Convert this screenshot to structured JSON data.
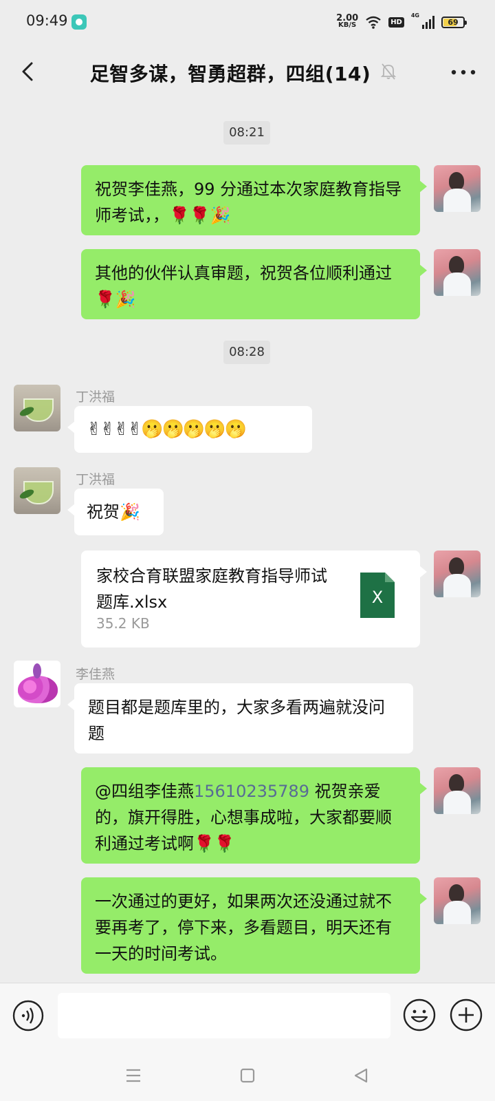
{
  "status_bar": {
    "time": "09:49",
    "net_speed_value": "2.00",
    "net_speed_unit": "KB/S",
    "hd_label": "HD",
    "network_type": "4G",
    "battery_level": "69"
  },
  "header": {
    "title": "足智多谋，智勇超群，四组(14)",
    "icons": [
      "back-icon",
      "mute-bell-icon",
      "more-icon"
    ]
  },
  "messages": {
    "time1": "08:21",
    "m1": "祝贺李佳燕，99 分通过本次家庭教育指导师考试，，🌹🌹🎉",
    "m2": "其他的伙伴认真审题，祝贺各位顺利通过🌹🎉",
    "time2": "08:28",
    "sender_ding": "丁洪福",
    "m3": "✌✌✌✌🫢🫢🫢🫢🫢",
    "m4": "祝贺🎉",
    "file": {
      "name": "家校合育联盟家庭教育指导师试题库.xlsx",
      "size": "35.2 KB",
      "icon_letter": "X"
    },
    "sender_li": "李佳燕",
    "m5": "题目都是题库里的，大家多看两遍就没问题",
    "m6_mention": "@四组李佳燕",
    "m6_number": "15610235789",
    "m6_rest": " 祝贺亲爱的，旗开得胜，心想事成啦，大家都要顺利通过考试啊🌹🌹",
    "m7": "一次通过的更好，如果两次还没通过就不要再考了，停下来，多看题目，明天还有一天的时间考试。"
  },
  "input_bar": {
    "icons": [
      "voice-icon",
      "emoji-icon",
      "plus-icon"
    ]
  },
  "colors": {
    "my_bubble": "#95EC69",
    "other_bubble": "#FFFFFF",
    "background": "#EDEDED",
    "link": "#576B95",
    "excel_green": "#1E7145"
  }
}
